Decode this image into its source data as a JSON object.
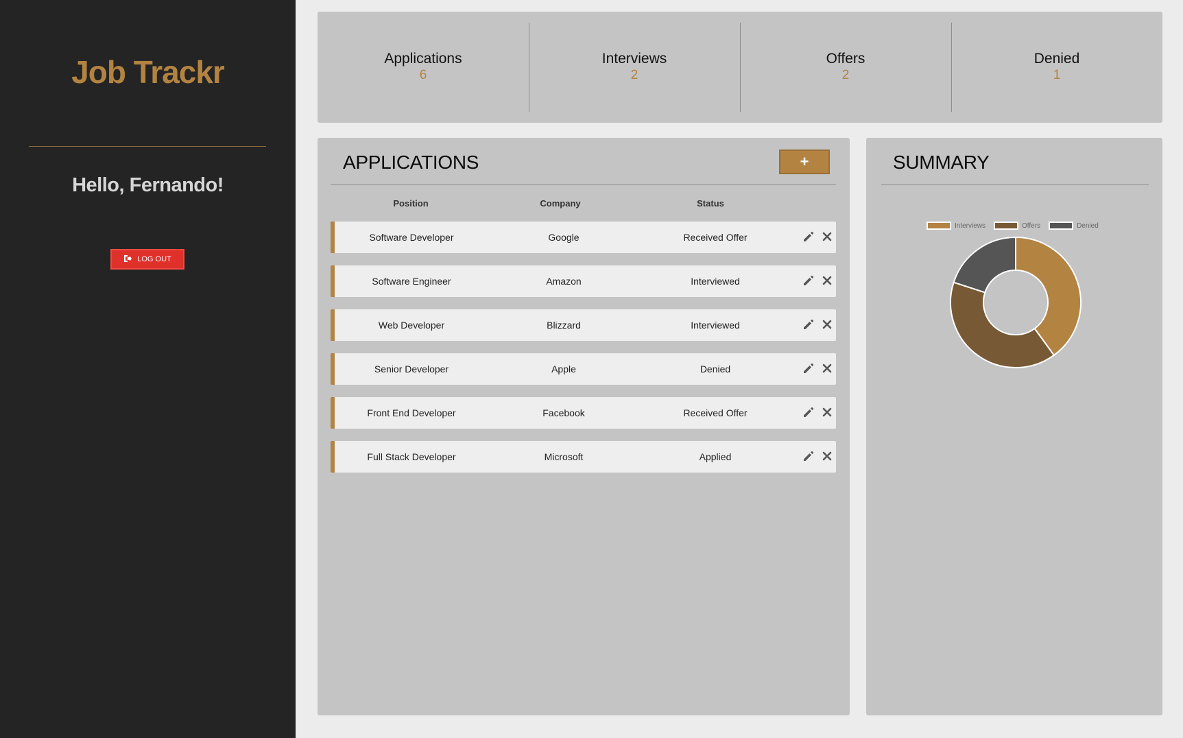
{
  "sidebar": {
    "brand": "Job Trackr",
    "greeting": "Hello, Fernando!",
    "logout_label": "LOG OUT"
  },
  "stats": [
    {
      "label": "Applications",
      "value": "6"
    },
    {
      "label": "Interviews",
      "value": "2"
    },
    {
      "label": "Offers",
      "value": "2"
    },
    {
      "label": "Denied",
      "value": "1"
    }
  ],
  "applications": {
    "title": "APPLICATIONS",
    "add_label": "+",
    "columns": [
      "Position",
      "Company",
      "Status"
    ],
    "rows": [
      {
        "position": "Software Developer",
        "company": "Google",
        "status": "Received Offer"
      },
      {
        "position": "Software Engineer",
        "company": "Amazon",
        "status": "Interviewed"
      },
      {
        "position": "Web Developer",
        "company": "Blizzard",
        "status": "Interviewed"
      },
      {
        "position": "Senior Developer",
        "company": "Apple",
        "status": "Denied"
      },
      {
        "position": "Front End Developer",
        "company": "Facebook",
        "status": "Received Offer"
      },
      {
        "position": "Full Stack Developer",
        "company": "Microsoft",
        "status": "Applied"
      }
    ]
  },
  "summary": {
    "title": "SUMMARY"
  },
  "colors": {
    "accent": "#b38342",
    "offers": "#775a35",
    "denied": "#555555",
    "logout": "#e0302a"
  },
  "chart_data": {
    "type": "pie",
    "categories": [
      "Interviews",
      "Offers",
      "Denied"
    ],
    "values": [
      2,
      2,
      1
    ],
    "colors": [
      "#b38342",
      "#775a35",
      "#555555"
    ],
    "donut": true,
    "legend": "top"
  }
}
